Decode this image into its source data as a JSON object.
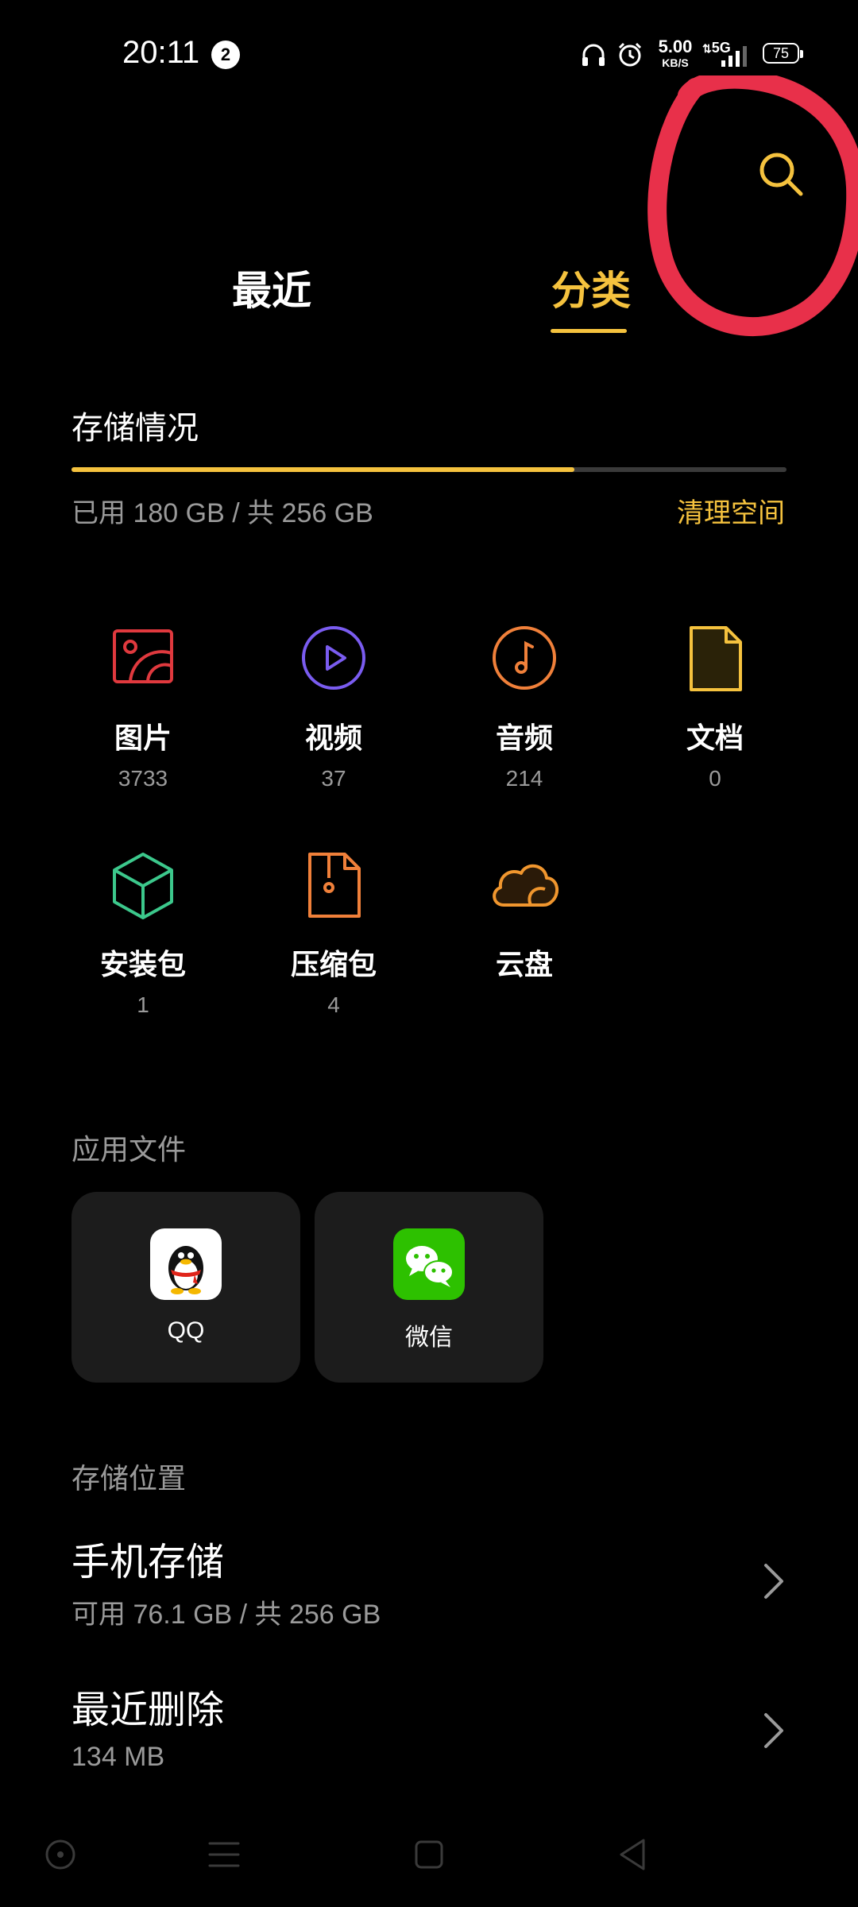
{
  "status": {
    "time": "20:11",
    "notification_count": "2",
    "net_speed": "5.00",
    "net_speed_unit": "KB/S",
    "network": "5G",
    "battery": "75"
  },
  "tabs": [
    {
      "label": "最近",
      "active": false
    },
    {
      "label": "分类",
      "active": true
    }
  ],
  "storage": {
    "heading": "存储情况",
    "used_text": "已用 180 GB / 共 256 GB",
    "used_fraction": 0.703,
    "clean_label": "清理空间"
  },
  "categories": [
    {
      "name": "图片",
      "count": "3733",
      "icon": "image-icon",
      "color": "#e0393e"
    },
    {
      "name": "视频",
      "count": "37",
      "icon": "video-play-icon",
      "color": "#7a5cf0"
    },
    {
      "name": "音频",
      "count": "214",
      "icon": "music-note-icon",
      "color": "#f0803a"
    },
    {
      "name": "文档",
      "count": "0",
      "icon": "document-icon",
      "color": "#f5c23e"
    },
    {
      "name": "安装包",
      "count": "1",
      "icon": "package-box-icon",
      "color": "#3cc88c"
    },
    {
      "name": "压缩包",
      "count": "4",
      "icon": "zip-file-icon",
      "color": "#f0803a"
    },
    {
      "name": "云盘",
      "count": "",
      "icon": "cloud-icon",
      "color": "#f0962e"
    }
  ],
  "app_files": {
    "heading": "应用文件",
    "apps": [
      {
        "label": "QQ",
        "icon": "qq-penguin-icon"
      },
      {
        "label": "微信",
        "icon": "wechat-icon",
        "color": "#2dc100"
      }
    ]
  },
  "locations": {
    "heading": "存储位置",
    "items": [
      {
        "title": "手机存储",
        "subtitle": "可用 76.1 GB / 共 256 GB"
      },
      {
        "title": "最近删除",
        "subtitle": "134 MB"
      }
    ]
  },
  "colors": {
    "accent": "#f5c23e",
    "background": "#000000",
    "annotation": "#e8304a"
  }
}
